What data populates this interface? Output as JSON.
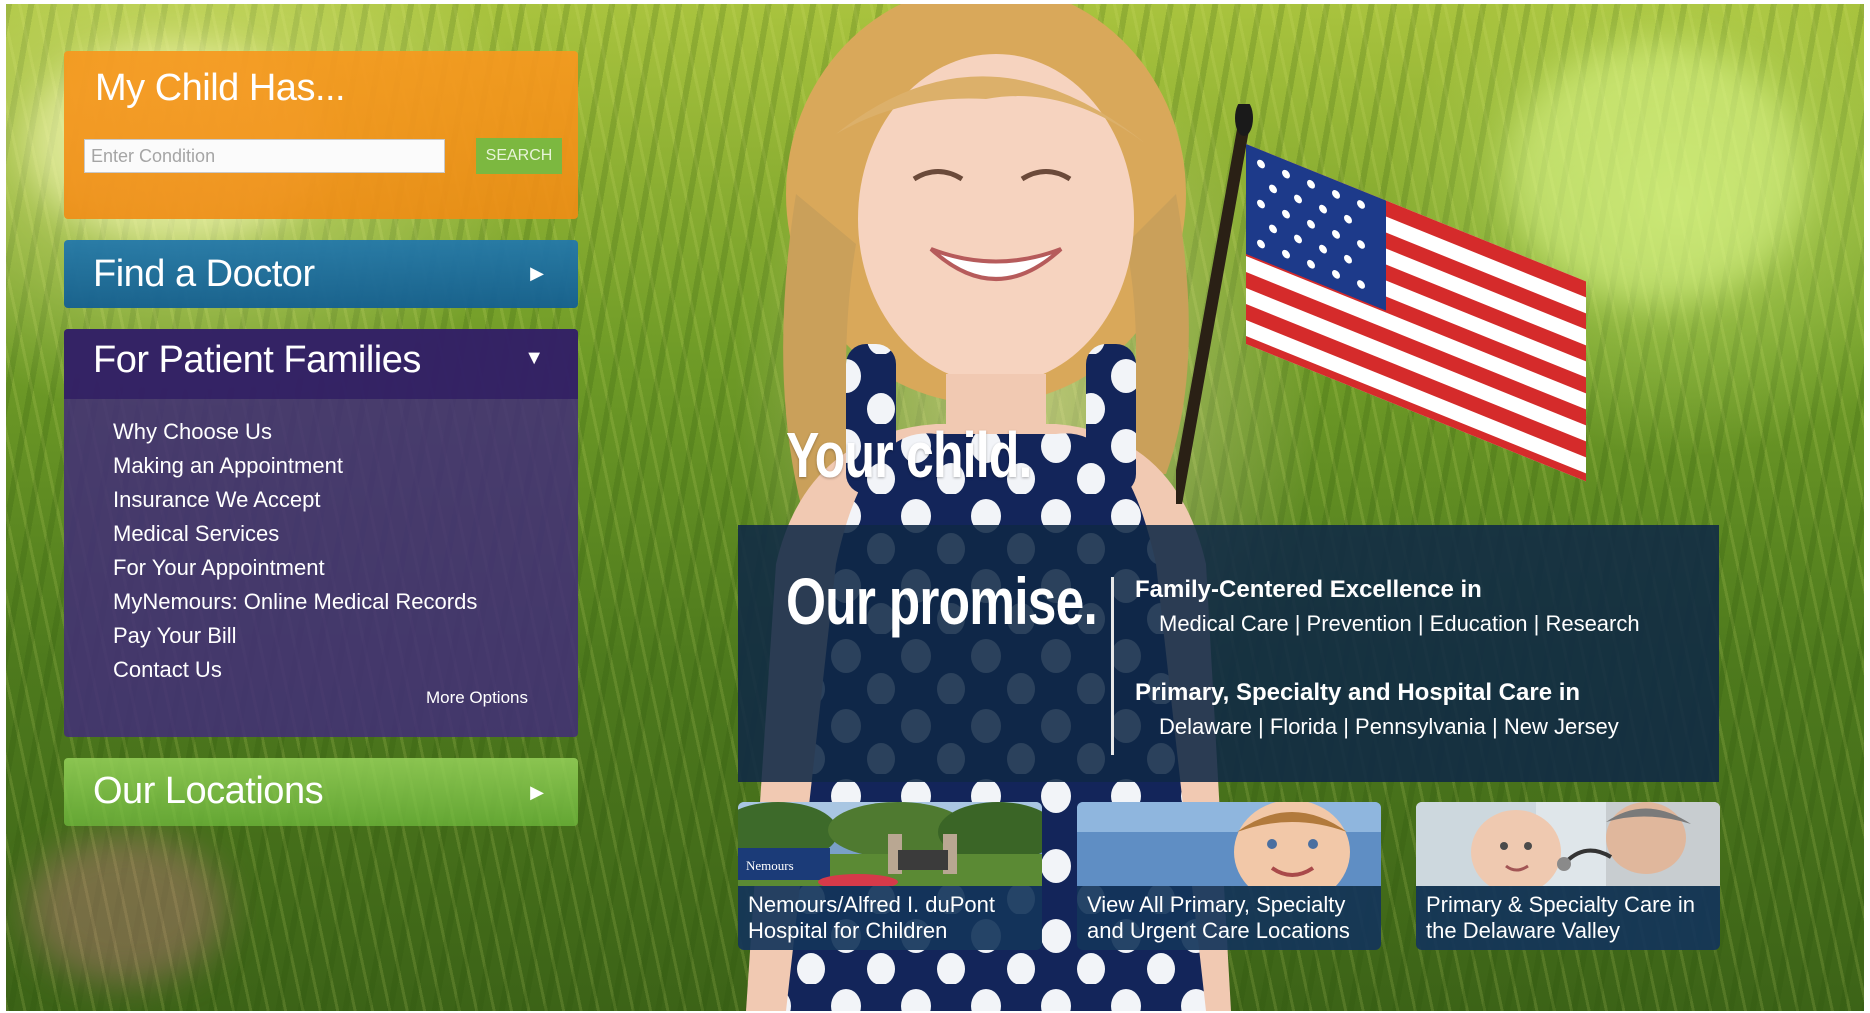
{
  "search": {
    "title": "My Child Has...",
    "placeholder": "Enter Condition",
    "button_label": "SEARCH"
  },
  "find_doctor": {
    "label": "Find a Doctor"
  },
  "patient_families": {
    "label": "For Patient Families",
    "items": [
      "Why Choose Us",
      "Making an Appointment",
      "Insurance We Accept",
      "Medical Services",
      "For Your Appointment",
      "MyNemours: Online Medical Records",
      "Pay Your Bill",
      "Contact Us"
    ],
    "more_options": "More Options"
  },
  "locations": {
    "label": "Our Locations"
  },
  "hero": {
    "tagline": "Your child.",
    "promise": "Our promise.",
    "line1_head": "Family-Centered Excellence in",
    "line1_sub": "Medical Care | Prevention | Education | Research",
    "line2_head": "Primary, Specialty and Hospital Care in",
    "line2_sub": "Delaware | Florida | Pennsylvania | New Jersey"
  },
  "tiles": [
    {
      "caption_1": "Nemours/Alfred I. duPont",
      "caption_2": "Hospital for Children",
      "sign": "Nemours"
    },
    {
      "caption_1": "View All Primary, Specialty",
      "caption_2": "and Urgent Care Locations"
    },
    {
      "caption_1": "Primary & Specialty Care in",
      "caption_2": "the Delaware Valley"
    }
  ],
  "colors": {
    "orange": "#f7981e",
    "blue": "#1f6f9f",
    "purple": "#42307a",
    "green": "#7cb840",
    "navy": "#0f2846"
  }
}
